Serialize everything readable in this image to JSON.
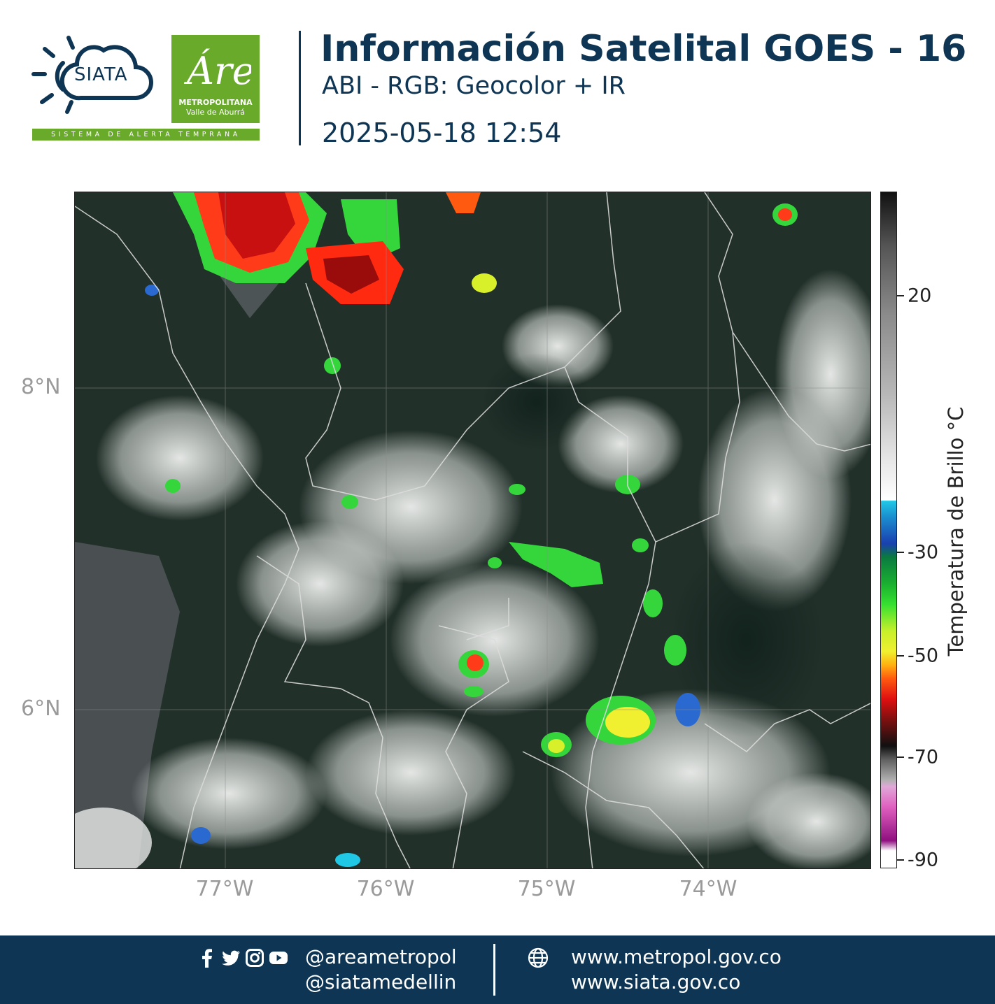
{
  "header": {
    "siata_name": "SIATA",
    "siata_tagline": "SISTEMA DE ALERTA TEMPRANA",
    "amva_script": "Área",
    "amva_line1": "METROPOLITANA",
    "amva_line2": "Valle de Aburrá",
    "title": "Información Satelital GOES - 16",
    "subtitle": "ABI - RGB: Geocolor + IR",
    "timestamp": "2025-05-18 12:54"
  },
  "map": {
    "lat_ticks": [
      "8°N",
      "6°N"
    ],
    "lon_ticks": [
      "77°W",
      "76°W",
      "75°W",
      "74°W"
    ],
    "lat_range": [
      4.97,
      9.17
    ],
    "lon_range": [
      -77.93,
      -72.97
    ]
  },
  "colorbar": {
    "title": "Temperatura de Brillo °C",
    "ticks": [
      "20",
      "-30",
      "-50",
      "-70",
      "-90"
    ],
    "range": [
      30,
      -91
    ]
  },
  "footer": {
    "social_icons": [
      "facebook-icon",
      "twitter-icon",
      "instagram-icon",
      "youtube-icon"
    ],
    "handle1": "@areametropol",
    "handle2": "@siatamedellin",
    "web1": "www.metropol.gov.co",
    "web2": "www.siata.gov.co"
  },
  "colors": {
    "brand_navy": "#0e3553",
    "brand_green": "#6aaa2b",
    "tick_gray": "#9a9a9a"
  }
}
